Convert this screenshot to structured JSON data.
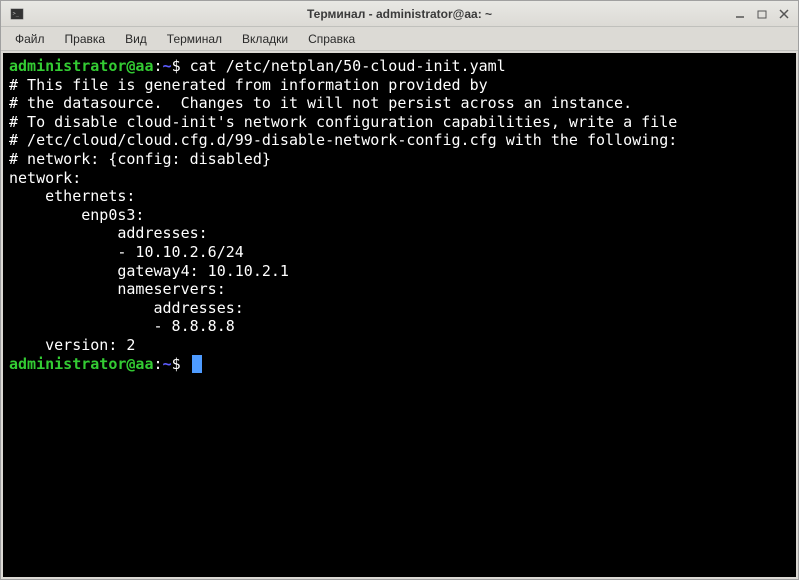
{
  "window": {
    "title": "Терминал - administrator@aa: ~"
  },
  "menu": {
    "file": "Файл",
    "edit": "Правка",
    "view": "Вид",
    "terminal": "Терминал",
    "tabs": "Вкладки",
    "help": "Справка"
  },
  "prompt": {
    "user_host": "administrator@aa",
    "colon": ":",
    "path": "~",
    "symbol": "$"
  },
  "command": "cat /etc/netplan/50-cloud-init.yaml",
  "output_lines": [
    "# This file is generated from information provided by",
    "# the datasource.  Changes to it will not persist across an instance.",
    "# To disable cloud-init's network configuration capabilities, write a file",
    "# /etc/cloud/cloud.cfg.d/99-disable-network-config.cfg with the following:",
    "# network: {config: disabled}",
    "network:",
    "    ethernets:",
    "        enp0s3:",
    "            addresses:",
    "            - 10.10.2.6/24",
    "            gateway4: 10.10.2.1",
    "            nameservers:",
    "                addresses:",
    "                - 8.8.8.8",
    "    version: 2"
  ]
}
